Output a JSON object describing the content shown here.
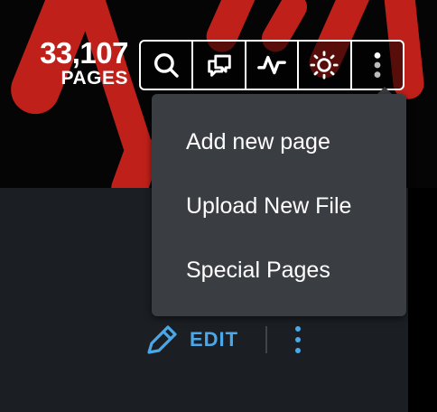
{
  "header": {
    "page_count": "33,107",
    "page_count_label": "PAGES"
  },
  "toolbar": {
    "buttons": [
      {
        "icon": "search-icon"
      },
      {
        "icon": "discussions-icon"
      },
      {
        "icon": "activity-icon"
      },
      {
        "icon": "theme-toggle-icon"
      },
      {
        "icon": "more-vertical-icon"
      }
    ]
  },
  "menu": {
    "items": [
      {
        "label": "Add new page"
      },
      {
        "label": "Upload New File"
      },
      {
        "label": "Special Pages"
      }
    ]
  },
  "page_actions": {
    "edit_label": "EDIT"
  },
  "colors": {
    "accent": "#4aa7e8",
    "menu_bg": "#3a3d42",
    "content_bg": "#1b1f24",
    "banner_red": "#c0201a"
  }
}
